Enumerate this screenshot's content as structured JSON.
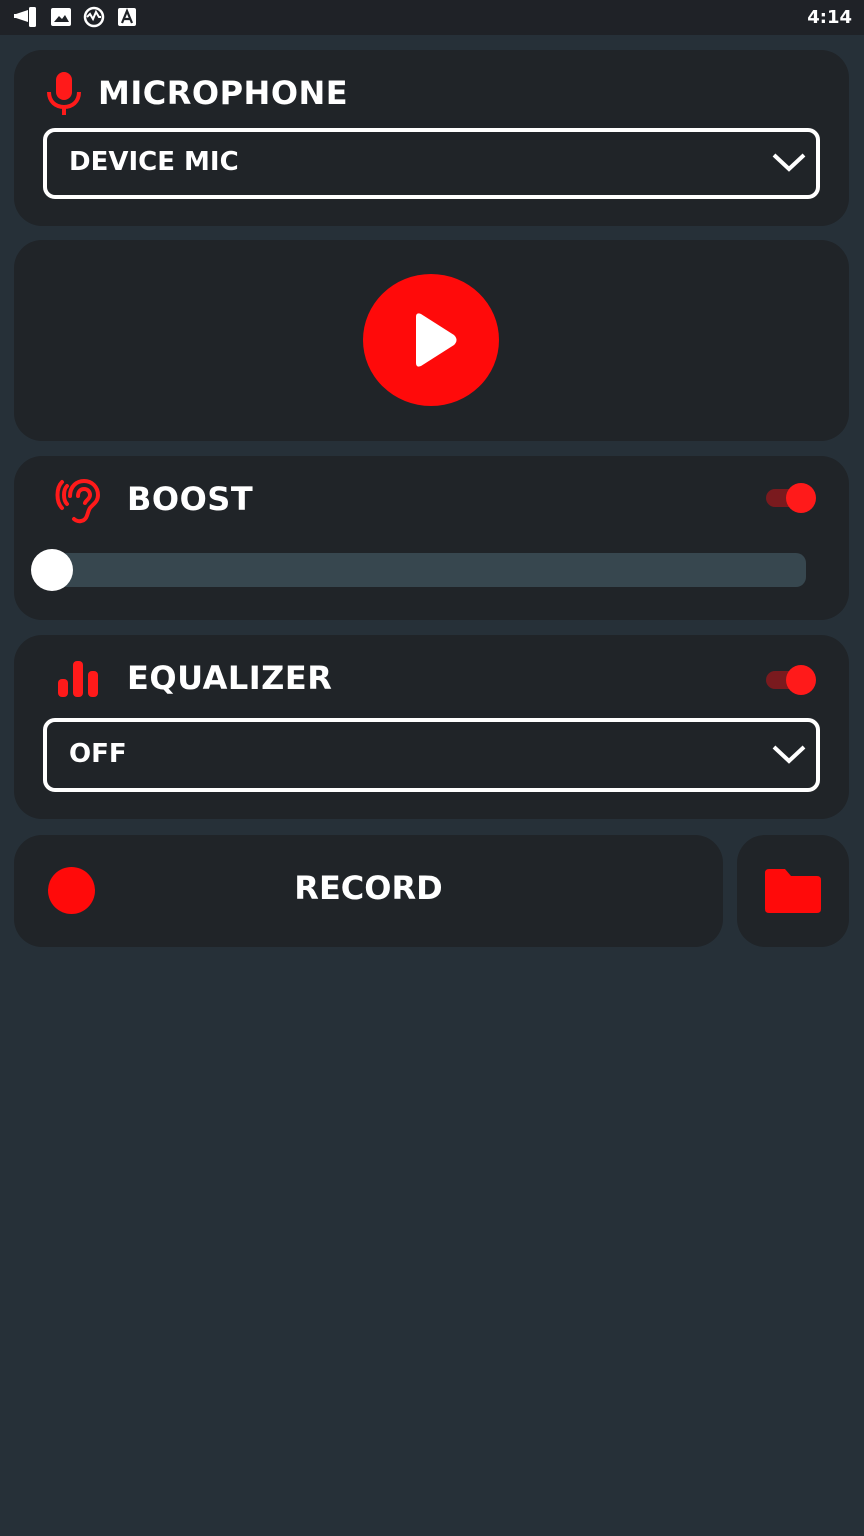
{
  "status_bar": {
    "time": "4:14",
    "icons": [
      "megaphone-icon",
      "image-icon",
      "sync-icon",
      "text-a-icon"
    ]
  },
  "microphone": {
    "title": "MICROPHONE",
    "selected": "DEVICE MIC",
    "icon": "microphone-icon"
  },
  "player": {
    "icon": "play-icon"
  },
  "boost": {
    "title": "BOOST",
    "icon": "ear-icon",
    "enabled": true,
    "level": 0
  },
  "equalizer": {
    "title": "EQUALIZER",
    "icon": "bars-icon",
    "enabled": true,
    "selected": "OFF"
  },
  "record": {
    "label": "RECORD",
    "icon": "record-dot-icon",
    "folder_icon": "folder-icon"
  },
  "colors": {
    "accent": "#ff0a0a",
    "background": "#263038",
    "card": "#202428",
    "slider_track": "#37474f"
  }
}
